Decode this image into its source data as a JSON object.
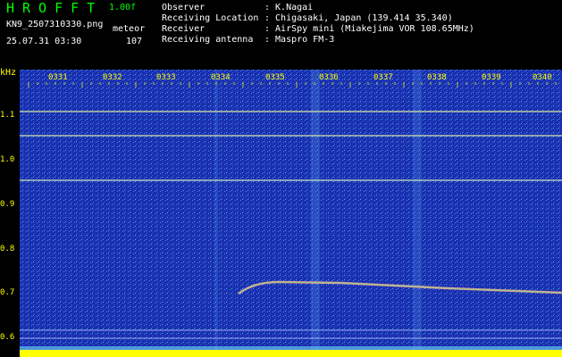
{
  "header": {
    "logo": "HROFFT",
    "version": "1.00f",
    "filename": "KN9_2507310330.png",
    "mode": "meteor",
    "datetime": "25.07.31 03:30",
    "count": "107",
    "info": [
      {
        "key": "Observer",
        "value": ": K.Nagai"
      },
      {
        "key": "Receiving Location",
        "value": ": Chigasaki, Japan (139.414 35.340)"
      },
      {
        "key": "Receiver",
        "value": ": AirSpy mini (Miakejima VOR 108.65MHz)"
      },
      {
        "key": "Receiving antenna",
        "value": ": Maspro FM-3"
      }
    ]
  },
  "plot": {
    "y_unit": "kHz",
    "time_labels": [
      "0331",
      "0332",
      "0333",
      "0334",
      "0335",
      "0336",
      "0337",
      "0338",
      "0339",
      "0340"
    ],
    "freq_labels": [
      "1.1",
      "1.0",
      "0.9",
      "0.8",
      "0.7",
      "0.6"
    ],
    "colors": {
      "bg": "#1a2fb0",
      "noise": "#3f7fe0",
      "line": "#e8e8c0",
      "trace": "#d04040",
      "bottom": "#ffff00"
    }
  }
}
